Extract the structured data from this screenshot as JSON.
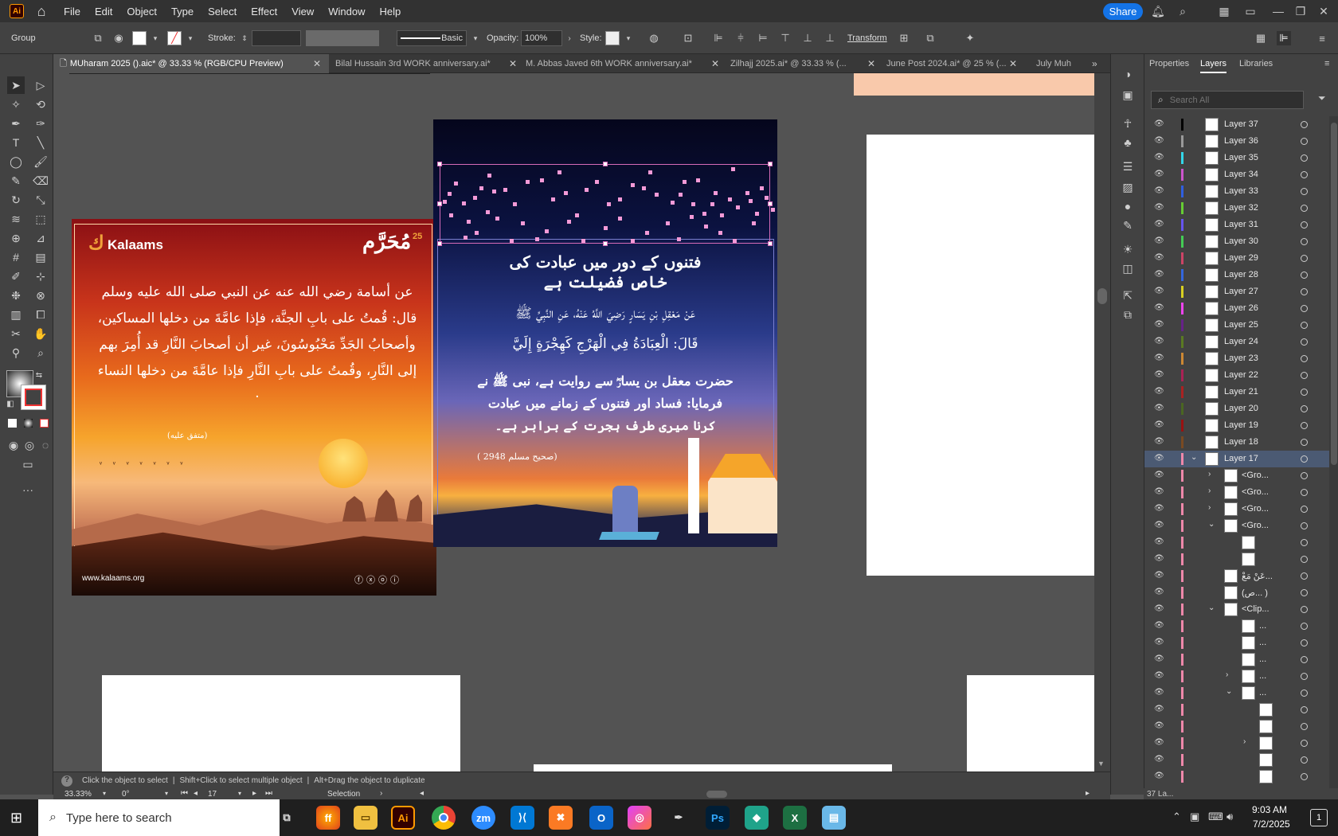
{
  "app": {
    "logo": "Ai"
  },
  "menu": [
    "File",
    "Edit",
    "Object",
    "Type",
    "Select",
    "Effect",
    "View",
    "Window",
    "Help"
  ],
  "share_label": "Share",
  "control": {
    "selection_type": "Group",
    "stroke_label": "Stroke:",
    "stroke_style": "Basic",
    "opacity_label": "Opacity:",
    "opacity_value": "100%",
    "style_label": "Style:",
    "transform_label": "Transform"
  },
  "tabs": [
    {
      "label": "MUharam 2025 ().aic* @ 33.33 % (RGB/CPU Preview)",
      "active": true
    },
    {
      "label": "Bilal Hussain  3rd  WORK anniversary.ai*"
    },
    {
      "label": "M. Abbas Javed  6th  WORK anniversary.ai*"
    },
    {
      "label": "Zilhajj 2025.ai* @ 33.33 % (..."
    },
    {
      "label": "June Post 2024.ai* @ 25 % (..."
    },
    {
      "label": "July Muh"
    }
  ],
  "panel": {
    "tabs": [
      "Properties",
      "Layers",
      "Libraries"
    ],
    "search_placeholder": "Search All",
    "footer_count": "37 La...",
    "layers": [
      {
        "name": "Layer 37",
        "color": "#000000"
      },
      {
        "name": "Layer 36",
        "color": "#9a9a9a"
      },
      {
        "name": "Layer 35",
        "color": "#33d6e8"
      },
      {
        "name": "Layer 34",
        "color": "#cc55cc"
      },
      {
        "name": "Layer 33",
        "color": "#2f5fe0"
      },
      {
        "name": "Layer 32",
        "color": "#66cc33"
      },
      {
        "name": "Layer 31",
        "color": "#6655ee"
      },
      {
        "name": "Layer 30",
        "color": "#44cc55"
      },
      {
        "name": "Layer 29",
        "color": "#cc4466"
      },
      {
        "name": "Layer 28",
        "color": "#3366dd"
      },
      {
        "name": "Layer 27",
        "color": "#d8d022"
      },
      {
        "name": "Layer 26",
        "color": "#ee44ee"
      },
      {
        "name": "Layer 25",
        "color": "#662288"
      },
      {
        "name": "Layer 24",
        "color": "#5a7a22"
      },
      {
        "name": "Layer 23",
        "color": "#cc8833"
      },
      {
        "name": "Layer 22",
        "color": "#aa2255"
      },
      {
        "name": "Layer 21",
        "color": "#aa2222"
      },
      {
        "name": "Layer 20",
        "color": "#4a6622"
      },
      {
        "name": "Layer 19",
        "color": "#991111"
      },
      {
        "name": "Layer 18",
        "color": "#7a4a22"
      },
      {
        "name": "Layer 17",
        "color": "#ee88aa",
        "selected": true
      }
    ],
    "sublayers": [
      "<Gro...",
      "<Gro...",
      "<Gro...",
      "<Gro...",
      "",
      "",
      "عَنْ مَعْ...",
      "(ص... )",
      "<Clip...",
      "...",
      "...",
      "...",
      "...",
      "...",
      "",
      "",
      "",
      "",
      ""
    ]
  },
  "status": {
    "hint_1": "Click the object to select",
    "hint_2": "Shift+Click to select multiple object",
    "hint_3": "Alt+Drag the object to duplicate",
    "zoom": "33.33%",
    "rotation": "0°",
    "artboard": "17",
    "tool": "Selection"
  },
  "artwork_left": {
    "brand": "Kalaams",
    "month": "مُحَرَّم",
    "year": "25",
    "hadith": "عن أسامة رضي الله عنه عن النبي صلى الله عليه وسلم قال: قُمتُ على بابِ الجنَّة، فإذا عامَّةَ من دخلها المساكين، وأصحابُ الجَدِّ مَحْبُوسُونَ، غير أن أصحابَ النَّارِ قد أُمِرَ بهم إلى النَّارِ، وقُمتُ على بابِ النَّارِ فإذا عامَّةَ من دخلها النساء ·",
    "reference": "(متفق عليه)",
    "website": "www.kalaams.org"
  },
  "artwork_center": {
    "title_1": "فتنوں کے دور میں عبادت کی",
    "title_2": "خاص فضیلت ہے",
    "arabic_1": "عَنْ مَعْقِلِ بْنِ يَسَارٍ رَضِيَ اللَّهُ عَنْهُ، عَنِ النَّبِيِّ ﷺ",
    "arabic_2": "قَالَ: الْعِبَادَةُ فِي الْهَرْجِ كَهِجْرَةٍ إِلَيَّ",
    "urdu_1": "حضرت معقل بن یسارؓ سے روایت ہے، نبی ﷺ نے",
    "urdu_2": "فرمایا: فساد اور فتنوں کے زمانے میں عبادت",
    "urdu_3": "کرنا میری طرف ہجرت کے برابر ہے۔",
    "reference": "(صحیح مسلم 2948 )"
  },
  "taskbar": {
    "search_placeholder": "Type here to search",
    "time": "9:03 AM",
    "date": "7/2/2025",
    "notification_count": "1"
  }
}
